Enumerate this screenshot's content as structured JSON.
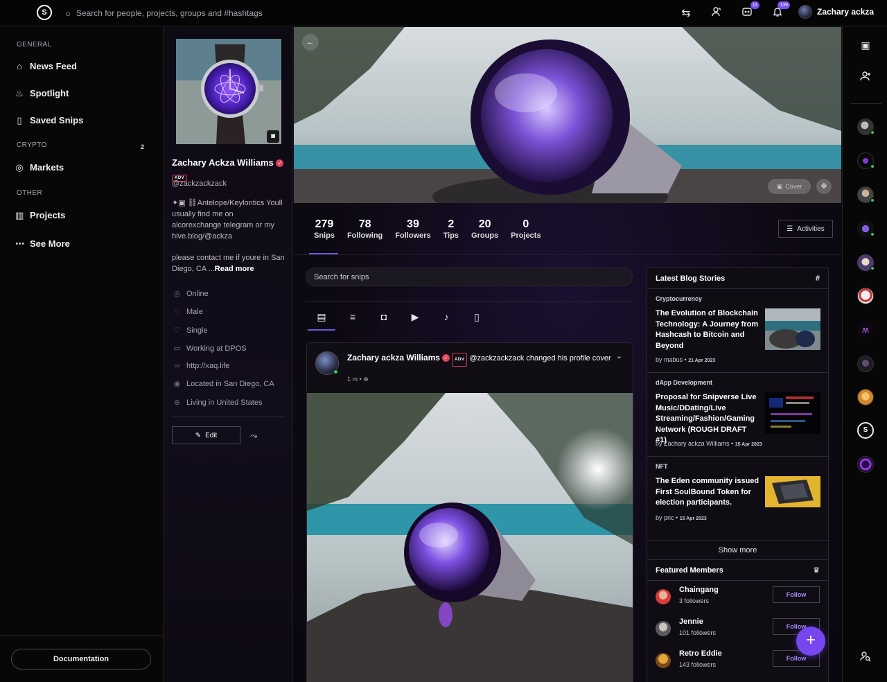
{
  "topbar": {
    "logo_text": "S",
    "search_placeholder": "Search for people, projects, groups and #hashtags",
    "messages_badge": "11",
    "notifications_badge": "139",
    "user_name": "Zachary ackza"
  },
  "leftnav": {
    "general_label": "GENERAL",
    "news_feed": "News Feed",
    "spotlight": "Spotlight",
    "saved_snips": "Saved Snips",
    "saved_count": "2",
    "crypto_label": "CRYPTO",
    "markets": "Markets",
    "other_label": "OTHER",
    "projects": "Projects",
    "see_more": "See More",
    "documentation": "Documentation"
  },
  "profile": {
    "name": "Zachary Ackza Williams",
    "adv": "ADV",
    "handle": "@zackzackzack",
    "bio_1": "✦▣ ⛓Antelope/Keylontics Youll usually find me on alcorexchange telegram or my hive.blog/@ackza",
    "bio_2": "please contact me if youre in San Diego, CA ...",
    "read_more": "Read more",
    "online": "Online",
    "gender": "Male",
    "relationship": "Single",
    "work": "Working at DPOS",
    "website": "http://xaq.life",
    "located": "Located in San Diego, CA",
    "living": "Living in United States",
    "edit": "Edit"
  },
  "cover": {
    "cover_label": "Cover"
  },
  "stats": [
    {
      "num": "279",
      "label": "Snips"
    },
    {
      "num": "78",
      "label": "Following"
    },
    {
      "num": "39",
      "label": "Followers"
    },
    {
      "num": "2",
      "label": "Tips"
    },
    {
      "num": "20",
      "label": "Groups"
    },
    {
      "num": "0",
      "label": "Projects"
    }
  ],
  "activities": "Activities",
  "snip_search_placeholder": "Search for snips",
  "post": {
    "author": "Zachary ackza Williams",
    "adv": "ADV",
    "action": "@zackzackzack changed his profile cover",
    "time": "1 m",
    "dot": "•"
  },
  "blog": {
    "title": "Latest Blog Stories",
    "items": [
      {
        "category": "Cryptocurrency",
        "title": "The Evolution of Blockchain Technology: A Journey from Hashcash to Bitcoin and Beyond",
        "by": "by mabus",
        "date": "21 Apr 2023"
      },
      {
        "category": "dApp Development",
        "title": "Proposal for Snipverse Live Music/DDating/Live Streaming/Fashion/Gaming Network (ROUGH DRAFT #1)",
        "by": "by Zachary ackza Williams",
        "date": "15 Apr 2023"
      },
      {
        "category": "NFT",
        "title": "The Eden community issued First SoulBound Token for election participants.",
        "by": "by pnc",
        "date": "15 Apr 2023"
      }
    ],
    "show_more": "Show more"
  },
  "members": {
    "title": "Featured Members",
    "items": [
      {
        "name": "Chaingang",
        "followers": "3 followers",
        "button": "Follow"
      },
      {
        "name": "Jennie",
        "followers": "101 followers",
        "button": "Follow"
      },
      {
        "name": "Retro Eddie",
        "followers": "143 followers",
        "button": "Follow"
      }
    ]
  },
  "colors": {
    "accent": "#7646ef",
    "online": "#3ac85b",
    "verified": "#e0405a"
  }
}
